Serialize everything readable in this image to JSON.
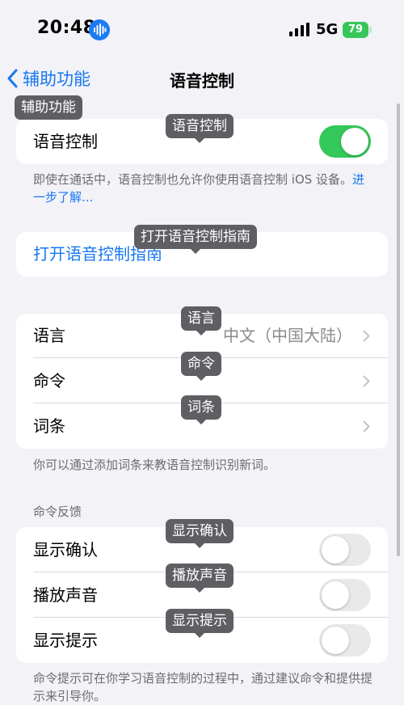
{
  "status_bar": {
    "time": "20:48",
    "network": "5G",
    "battery": "79"
  },
  "nav": {
    "back_label": "辅助功能",
    "title": "语音控制"
  },
  "voice_control": {
    "label": "语音控制",
    "enabled": true
  },
  "description": {
    "text": "即使在通话中，语音控制也允许你使用语音控制 iOS 设备。",
    "link": "进一步了解..."
  },
  "guide": {
    "label": "打开语音控制指南"
  },
  "settings": {
    "language_label": "语言",
    "language_value": "中文（中国大陆）",
    "commands_label": "命令",
    "vocabulary_label": "词条",
    "footnote": "你可以通过添加词条来教语音控制识别新词。"
  },
  "feedback": {
    "header": "命令反馈",
    "show_confirmation": {
      "label": "显示确认",
      "enabled": false
    },
    "play_sound": {
      "label": "播放声音",
      "enabled": false
    },
    "show_hints": {
      "label": "显示提示",
      "enabled": false
    },
    "footnote": "命令提示可在你学习语音控制的过程中，通过建议命令和提供提示来引导你。"
  },
  "tooltips": {
    "back": "辅助功能",
    "voice_control": "语音控制",
    "guide": "打开语音控制指南",
    "language": "语言",
    "commands": "命令",
    "vocabulary": "词条",
    "show_confirmation": "显示确认",
    "play_sound": "播放声音",
    "show_hints": "显示提示"
  },
  "colors": {
    "accent": "#1878f0",
    "toggle_on": "#34c759",
    "battery": "#35c759",
    "tooltip": "#5f5f63"
  }
}
